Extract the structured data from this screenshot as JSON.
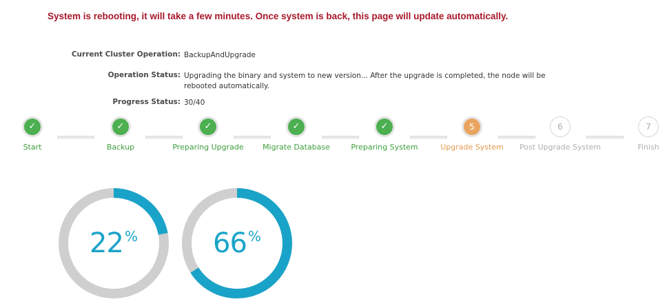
{
  "banner": {
    "message": "System is rebooting, it will take a few minutes. Once system is back, this page will update automatically."
  },
  "info": {
    "operation_label": "Current Cluster Operation:",
    "operation_value": "BackupAndUpgrade",
    "status_label": "Operation Status:",
    "status_value": "Upgrading the binary and system to new version... After the upgrade is completed, the node will be rebooted automatically.",
    "progress_label": "Progress Status:",
    "progress_value": "30/40"
  },
  "steps": [
    {
      "label": "Start",
      "state": "done",
      "marker": "✓"
    },
    {
      "label": "Backup",
      "state": "done",
      "marker": "✓"
    },
    {
      "label": "Preparing Upgrade",
      "state": "done",
      "marker": "✓"
    },
    {
      "label": "Migrate Database",
      "state": "done",
      "marker": "✓"
    },
    {
      "label": "Preparing System",
      "state": "done",
      "marker": "✓"
    },
    {
      "label": "Upgrade System",
      "state": "current",
      "marker": "5"
    },
    {
      "label": "Post Upgrade System",
      "state": "todo",
      "marker": "6"
    },
    {
      "label": "Finish",
      "state": "todo",
      "marker": "7"
    }
  ],
  "gauges": [
    {
      "value": 22,
      "value_text": "22",
      "unit": "%"
    },
    {
      "value": 66,
      "value_text": "66",
      "unit": "%"
    }
  ],
  "colors": {
    "banner": "#a8182a",
    "done": "#4caf50",
    "current": "#e9a55f",
    "todo": "#b0b0b0",
    "gauge_fill": "#1aa3c8",
    "gauge_track": "#cfcfcf"
  }
}
